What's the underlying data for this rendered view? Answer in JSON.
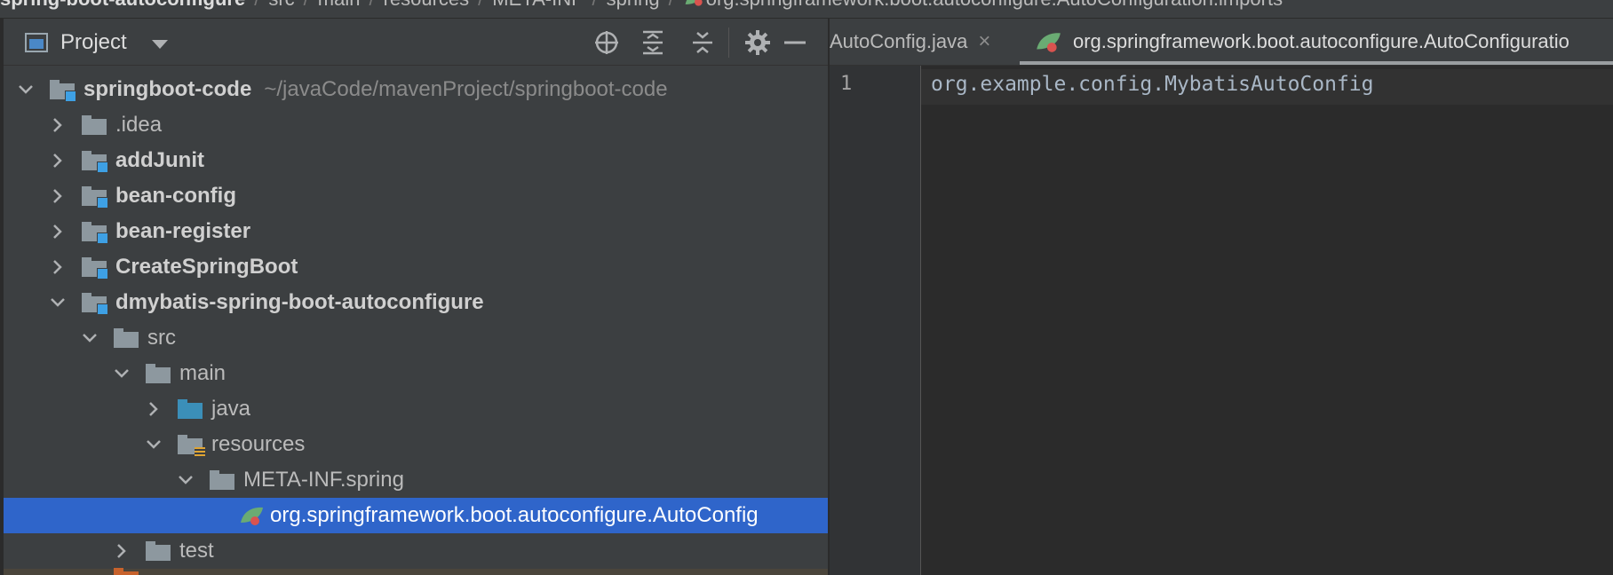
{
  "breadcrumb": {
    "items": [
      "spring-boot-autoconfigure",
      "src",
      "main",
      "resources",
      "META-INF",
      "spring",
      "org.springframework.boot.autoconfigure.AutoConfiguration.imports"
    ],
    "separator": "/"
  },
  "project_panel": {
    "title": "Project",
    "icons": [
      "locate-icon",
      "expand-all-icon",
      "collapse-all-icon",
      "gear-icon",
      "minimize-icon"
    ]
  },
  "tree": {
    "root_label": "springboot-code",
    "root_path": "~/javaCode/mavenProject/springboot-code",
    "items": [
      {
        "label": ".idea"
      },
      {
        "label": "addJunit"
      },
      {
        "label": "bean-config"
      },
      {
        "label": "bean-register"
      },
      {
        "label": "CreateSpringBoot"
      },
      {
        "label": "dmybatis-spring-boot-autoconfigure"
      },
      {
        "label": "src"
      },
      {
        "label": "main"
      },
      {
        "label": "java"
      },
      {
        "label": "resources"
      },
      {
        "label": "META-INF.spring"
      },
      {
        "label": "org.springframework.boot.autoconfigure.AutoConfig"
      },
      {
        "label": "test"
      }
    ]
  },
  "editor": {
    "tabs": [
      {
        "label": "AutoConfig.java",
        "close": "×"
      },
      {
        "label": "org.springframework.boot.autoconfigure.AutoConfiguratio"
      }
    ],
    "line_number": "1",
    "code": "org.example.config.MybatisAutoConfig"
  },
  "colors": {
    "panel_bg": "#3c3f41",
    "editor_bg": "#2b2b2b",
    "selection": "#2f65ca",
    "code_text": "#a9b7c6"
  }
}
